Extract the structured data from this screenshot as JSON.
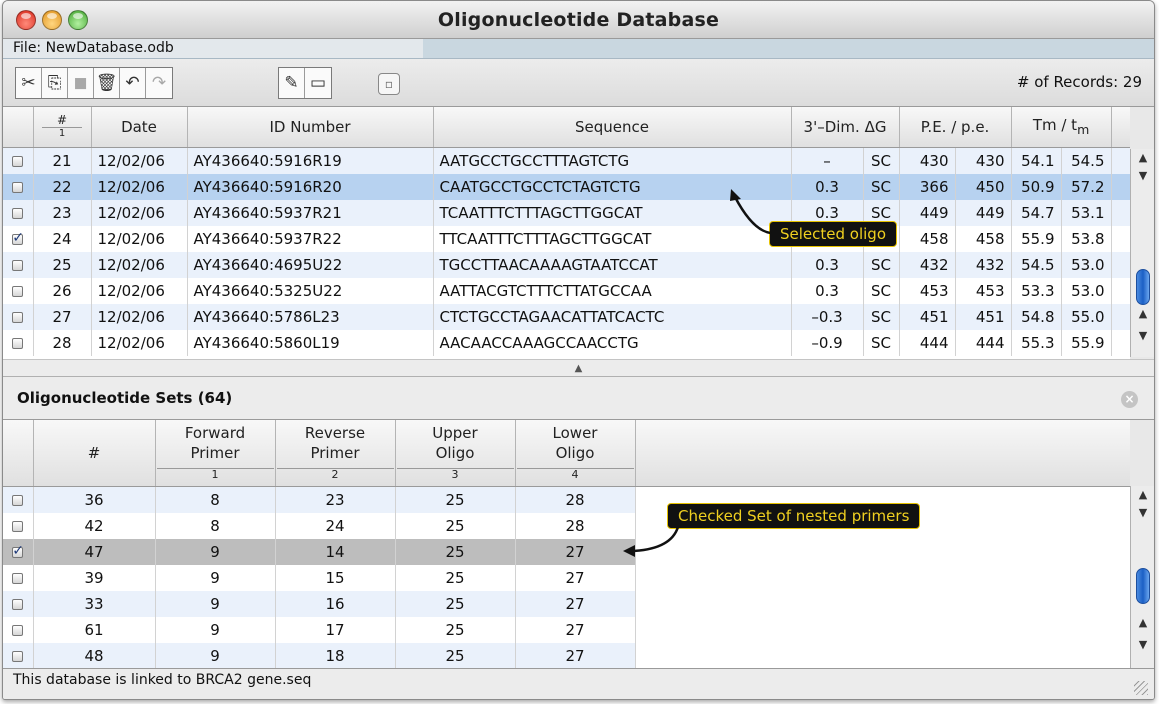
{
  "window": {
    "title": "Oligonucleotide Database"
  },
  "filebar": {
    "file_label": "File: NewDatabase.odb"
  },
  "toolbar": {
    "buttons": [
      {
        "name": "cut-button",
        "icon": "scissors-icon",
        "glyph": "✂"
      },
      {
        "name": "copy-button",
        "icon": "copy-icon",
        "glyph": "⎘"
      },
      {
        "name": "paste-button",
        "icon": "paste-icon",
        "glyph": "◼"
      },
      {
        "name": "delete-button",
        "icon": "trash-icon",
        "glyph": "🗑"
      },
      {
        "name": "undo-button",
        "icon": "undo-icon",
        "glyph": "↶"
      },
      {
        "name": "redo-button",
        "icon": "redo-icon",
        "glyph": "↷"
      }
    ],
    "view_buttons": [
      {
        "name": "edit-record-button",
        "icon": "pencil-icon",
        "glyph": "✎"
      },
      {
        "name": "window-button",
        "icon": "window-icon",
        "glyph": "▭"
      }
    ],
    "records_label": "# of Records: 29"
  },
  "oligo_table": {
    "headers": {
      "num": "#",
      "num_sub": "1",
      "date": "Date",
      "id": "ID Number",
      "sequence": "Sequence",
      "dimer": "3'–Dim. ΔG",
      "pe": "P.E. / p.e.",
      "tm_prefix": "Tm / t",
      "tm_sub": "m"
    },
    "rows": [
      {
        "checked": false,
        "num": "21",
        "date": "12/02/06",
        "id": "AY436640:5916R19",
        "seq": "AATGCCTGCCTTTAGTCTG",
        "dg": "–",
        "sc": "SC",
        "pe1": "430",
        "pe2": "430",
        "tm1": "54.1",
        "tm2": "54.5"
      },
      {
        "checked": false,
        "num": "22",
        "date": "12/02/06",
        "id": "AY436640:5916R20",
        "seq": "CAATGCCTGCCTCTAGTCTG",
        "dg": "0.3",
        "sc": "SC",
        "pe1": "366",
        "pe2": "450",
        "tm1": "50.9",
        "tm2": "57.2"
      },
      {
        "checked": false,
        "num": "23",
        "date": "12/02/06",
        "id": "AY436640:5937R21",
        "seq": "TCAATTTCTTTAGCTTGGCAT",
        "dg": "0.3",
        "sc": "SC",
        "pe1": "449",
        "pe2": "449",
        "tm1": "54.7",
        "tm2": "53.1"
      },
      {
        "checked": true,
        "num": "24",
        "date": "12/02/06",
        "id": "AY436640:5937R22",
        "seq": "TTCAATTTCTTTAGCTTGGCAT",
        "dg": "",
        "sc": "",
        "pe1": "458",
        "pe2": "458",
        "tm1": "55.9",
        "tm2": "53.8"
      },
      {
        "checked": false,
        "num": "25",
        "date": "12/02/06",
        "id": "AY436640:4695U22",
        "seq": "TGCCTTAACAAAAGTAATCCAT",
        "dg": "0.3",
        "sc": "SC",
        "pe1": "432",
        "pe2": "432",
        "tm1": "54.5",
        "tm2": "53.0"
      },
      {
        "checked": false,
        "num": "26",
        "date": "12/02/06",
        "id": "AY436640:5325U22",
        "seq": "AATTACGTCTTTCTTATGCCAA",
        "dg": "0.3",
        "sc": "SC",
        "pe1": "453",
        "pe2": "453",
        "tm1": "53.3",
        "tm2": "53.0"
      },
      {
        "checked": false,
        "num": "27",
        "date": "12/02/06",
        "id": "AY436640:5786L23",
        "seq": "CTCTGCCTAGAACATTATCACTC",
        "dg": "–0.3",
        "sc": "SC",
        "pe1": "451",
        "pe2": "451",
        "tm1": "54.8",
        "tm2": "55.0"
      },
      {
        "checked": false,
        "num": "28",
        "date": "12/02/06",
        "id": "AY436640:5860L19",
        "seq": "AACAACCAAAGCCAACCTG",
        "dg": "–0.9",
        "sc": "SC",
        "pe1": "444",
        "pe2": "444",
        "tm1": "55.3",
        "tm2": "55.9"
      }
    ],
    "selected_index": 1
  },
  "sets": {
    "title": "Oligonucleotide Sets  (64)",
    "close_glyph": "×",
    "headers": {
      "num": "#",
      "fwd_1": "Forward",
      "fwd_2": "Primer",
      "fwd_sub": "1",
      "rev_1": "Reverse",
      "rev_2": "Primer",
      "rev_sub": "2",
      "up_1": "Upper",
      "up_2": "Oligo",
      "up_sub": "3",
      "low_1": "Lower",
      "low_2": "Oligo",
      "low_sub": "4"
    },
    "rows": [
      {
        "checked": false,
        "num": "36",
        "fwd": "8",
        "rev": "23",
        "up": "25",
        "low": "28"
      },
      {
        "checked": false,
        "num": "42",
        "fwd": "8",
        "rev": "24",
        "up": "25",
        "low": "28"
      },
      {
        "checked": true,
        "num": "47",
        "fwd": "9",
        "rev": "14",
        "up": "25",
        "low": "27"
      },
      {
        "checked": false,
        "num": "39",
        "fwd": "9",
        "rev": "15",
        "up": "25",
        "low": "27"
      },
      {
        "checked": false,
        "num": "33",
        "fwd": "9",
        "rev": "16",
        "up": "25",
        "low": "27"
      },
      {
        "checked": false,
        "num": "61",
        "fwd": "9",
        "rev": "17",
        "up": "25",
        "low": "27"
      },
      {
        "checked": false,
        "num": "48",
        "fwd": "9",
        "rev": "18",
        "up": "25",
        "low": "27"
      }
    ]
  },
  "callouts": {
    "selected_oligo": "Selected oligo",
    "checked_set": "Checked Set of nested primers"
  },
  "status": {
    "text": "This database is linked to BRCA2 gene.seq"
  },
  "colors": {
    "selection": "#b7d2f0",
    "checked_set_row": "#bdbdbd",
    "callout_text": "#f0d020"
  }
}
